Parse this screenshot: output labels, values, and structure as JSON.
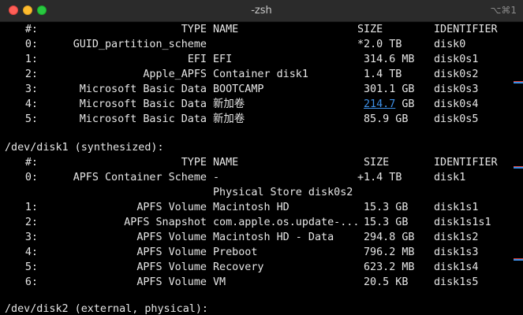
{
  "window": {
    "title": "-zsh",
    "shortcut": "⌥⌘1"
  },
  "disk0_header": {
    "num": "#:",
    "type": "TYPE",
    "name": "NAME",
    "size": "SIZE",
    "identifier": "IDENTIFIER"
  },
  "disk0_rows": [
    {
      "num": "0:",
      "type": "GUID_partition_scheme",
      "name": "",
      "size": "*2.0 TB",
      "identifier": "disk0"
    },
    {
      "num": "1:",
      "type": "EFI",
      "name": "EFI",
      "size": "314.6 MB",
      "identifier": "disk0s1"
    },
    {
      "num": "2:",
      "type": "Apple_APFS",
      "name": "Container disk1",
      "size": "1.4 TB",
      "identifier": "disk0s2"
    },
    {
      "num": "3:",
      "type": "Microsoft Basic Data",
      "name": "BOOTCAMP",
      "size": "301.1 GB",
      "identifier": "disk0s3"
    },
    {
      "num": "4:",
      "type": "Microsoft Basic Data",
      "name": "新加卷",
      "size_link": "214.7",
      "size_unit": " GB",
      "identifier": "disk0s4"
    },
    {
      "num": "5:",
      "type": "Microsoft Basic Data",
      "name": "新加卷",
      "size": "85.9 GB",
      "identifier": "disk0s5"
    }
  ],
  "disk1_line": "/dev/disk1 (synthesized):",
  "disk1_header": {
    "num": "#:",
    "type": "TYPE",
    "name": "NAME",
    "size": "SIZE",
    "identifier": "IDENTIFIER"
  },
  "disk1_rows": [
    {
      "num": "0:",
      "type": "APFS Container Scheme",
      "name": "-",
      "size": "+1.4 TB",
      "identifier": "disk1"
    },
    {
      "num": "",
      "type": "",
      "name": "Physical Store disk0s2",
      "size": "",
      "identifier": ""
    },
    {
      "num": "1:",
      "type": "APFS Volume",
      "name": "Macintosh HD",
      "size": "15.3 GB",
      "identifier": "disk1s1"
    },
    {
      "num": "2:",
      "type": "APFS Snapshot",
      "name": "com.apple.os.update-...",
      "size": "15.3 GB",
      "identifier": "disk1s1s1"
    },
    {
      "num": "3:",
      "type": "APFS Volume",
      "name": "Macintosh HD - Data",
      "size": "294.8 GB",
      "identifier": "disk1s2"
    },
    {
      "num": "4:",
      "type": "APFS Volume",
      "name": "Preboot",
      "size": "796.2 MB",
      "identifier": "disk1s3"
    },
    {
      "num": "5:",
      "type": "APFS Volume",
      "name": "Recovery",
      "size": "623.2 MB",
      "identifier": "disk1s4"
    },
    {
      "num": "6:",
      "type": "APFS Volume",
      "name": "VM",
      "size": "20.5 KB",
      "identifier": "disk1s5"
    }
  ],
  "disk2_line": "/dev/disk2 (external, physical):",
  "colors": {
    "background": "#000000",
    "text": "#e6e6e6",
    "link": "#3d8fe6",
    "scroll_mark_red": "#e0443e",
    "scroll_mark_blue": "#3d8fe6"
  }
}
